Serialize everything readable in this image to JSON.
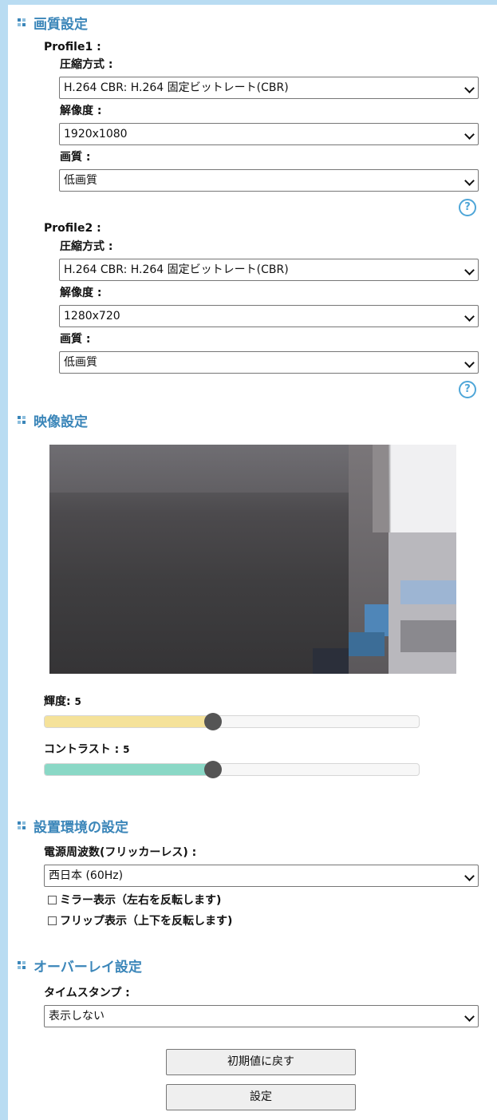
{
  "sections": {
    "quality": "画質設定",
    "video": "映像設定",
    "environment": "設置環境の設定",
    "overlay": "オーバーレイ設定"
  },
  "profile1": {
    "label": "Profile1 :",
    "codec_label": "圧縮方式 :",
    "codec_value": "H.264 CBR: H.264 固定ビットレート(CBR)",
    "resolution_label": "解像度 :",
    "resolution_value": "1920x1080",
    "quality_label": "画質 :",
    "quality_value": "低画質"
  },
  "profile2": {
    "label": "Profile2 :",
    "codec_label": "圧縮方式 :",
    "codec_value": "H.264 CBR: H.264 固定ビットレート(CBR)",
    "resolution_label": "解像度 :",
    "resolution_value": "1280x720",
    "quality_label": "画質 :",
    "quality_value": "低画質"
  },
  "help_icon": "?",
  "brightness": {
    "label": "輝度:",
    "value": "5",
    "level_fraction": 0.45,
    "color": "#f5e29a"
  },
  "contrast": {
    "label": "コントラスト :",
    "value": "5",
    "level_fraction": 0.45,
    "color": "#8ad8c6"
  },
  "environment": {
    "freq_label": "電源周波数(フリッカーレス) :",
    "freq_value": "西日本 (60Hz)",
    "mirror_label": "ミラー表示（左右を反転します)",
    "flip_label": "フリップ表示（上下を反転します)"
  },
  "overlay": {
    "timestamp_label": "タイムスタンプ :",
    "timestamp_value": "表示しない"
  },
  "buttons": {
    "reset": "初期値に戻す",
    "apply": "設定"
  },
  "colors": {
    "accent": "#3b86b9",
    "help": "#4fa6d8",
    "frame": "#b9dcf2"
  }
}
